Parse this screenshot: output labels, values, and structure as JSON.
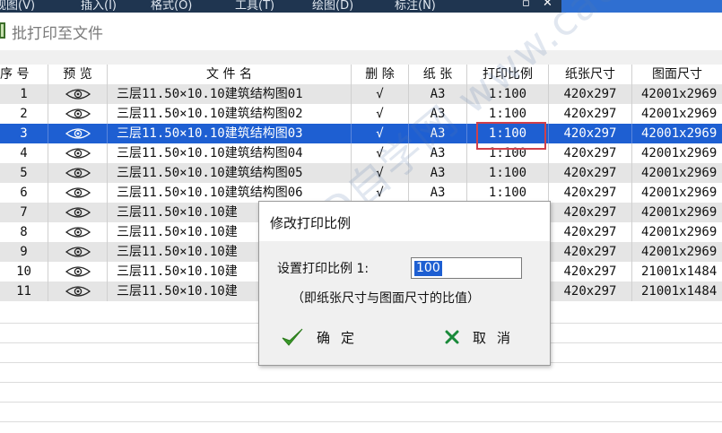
{
  "menubar": {
    "items": [
      "视图(V)",
      "插入(I)",
      "格式(O)",
      "工具(T)",
      "绘图(D)",
      "标注(N)"
    ]
  },
  "window": {
    "title": "批打印至文件"
  },
  "columns": [
    "序 号",
    "预 览",
    "文 件 名",
    "删 除",
    "纸 张",
    "打印比例",
    "纸张尺寸",
    "图面尺寸"
  ],
  "rows": [
    {
      "no": "1",
      "name": "三层11.50×10.10建筑结构图01",
      "del": "√",
      "paper": "A3",
      "scale": "1:100",
      "paper_size": "420x297",
      "drawing_size": "42001x2969"
    },
    {
      "no": "2",
      "name": "三层11.50×10.10建筑结构图02",
      "del": "√",
      "paper": "A3",
      "scale": "1:100",
      "paper_size": "420x297",
      "drawing_size": "42001x2969"
    },
    {
      "no": "3",
      "name": "三层11.50×10.10建筑结构图03",
      "del": "√",
      "paper": "A3",
      "scale": "1:100",
      "paper_size": "420x297",
      "drawing_size": "42001x2969"
    },
    {
      "no": "4",
      "name": "三层11.50×10.10建筑结构图04",
      "del": "√",
      "paper": "A3",
      "scale": "1:100",
      "paper_size": "420x297",
      "drawing_size": "42001x2969"
    },
    {
      "no": "5",
      "name": "三层11.50×10.10建筑结构图05",
      "del": "√",
      "paper": "A3",
      "scale": "1:100",
      "paper_size": "420x297",
      "drawing_size": "42001x2969"
    },
    {
      "no": "6",
      "name": "三层11.50×10.10建筑结构图06",
      "del": "√",
      "paper": "A3",
      "scale": "1:100",
      "paper_size": "420x297",
      "drawing_size": "42001x2969"
    },
    {
      "no": "7",
      "name": "三层11.50×10.10建",
      "del": "",
      "paper": "",
      "scale": "",
      "paper_size": "420x297",
      "drawing_size": "42001x2969"
    },
    {
      "no": "8",
      "name": "三层11.50×10.10建",
      "del": "",
      "paper": "",
      "scale": "",
      "paper_size": "420x297",
      "drawing_size": "42001x2969"
    },
    {
      "no": "9",
      "name": "三层11.50×10.10建",
      "del": "",
      "paper": "",
      "scale": "",
      "paper_size": "420x297",
      "drawing_size": "42001x2969"
    },
    {
      "no": "10",
      "name": "三层11.50×10.10建",
      "del": "",
      "paper": "",
      "scale": "",
      "paper_size": "420x297",
      "drawing_size": "21001x1484"
    },
    {
      "no": "11",
      "name": "三层11.50×10.10建",
      "del": "",
      "paper": "",
      "scale": "",
      "paper_size": "420x297",
      "drawing_size": "21001x1484"
    }
  ],
  "selected_row": 3,
  "watermark": "CAD自学网 www.cadzxw.com",
  "dialog": {
    "title": "修改打印比例",
    "label": "设置打印比例 1:",
    "value": "100",
    "note": "（即纸张尺寸与图面尺寸的比值）",
    "ok_label": "确定",
    "cancel_label": "取消"
  },
  "colors": {
    "selection": "#1e5fd2",
    "alt_row": "#e5e5e5",
    "highlight_box": "#d0404a",
    "ok_check": "#3a9a2a",
    "cancel_x": "#1a8a3a"
  },
  "icons": {
    "preview": "eye-icon",
    "ok": "check-icon",
    "cancel": "x-icon",
    "app": "app-icon"
  }
}
